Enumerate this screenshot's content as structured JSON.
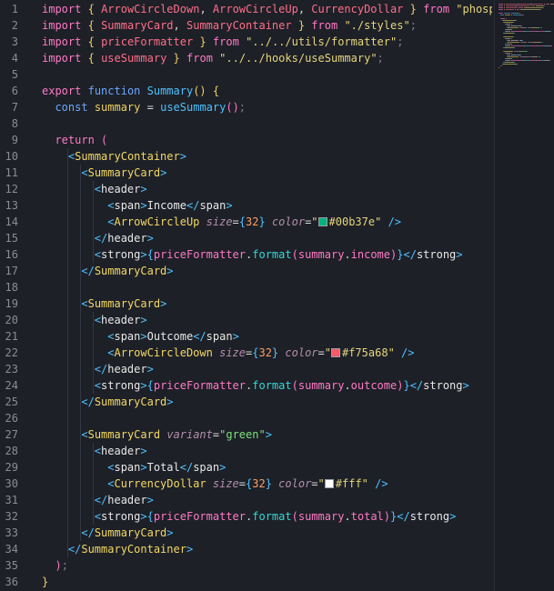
{
  "line_numbers": [
    "1",
    "2",
    "3",
    "4",
    "5",
    "6",
    "7",
    "8",
    "9",
    "10",
    "11",
    "12",
    "13",
    "14",
    "15",
    "16",
    "17",
    "18",
    "19",
    "20",
    "21",
    "22",
    "23",
    "24",
    "25",
    "26",
    "27",
    "28",
    "29",
    "30",
    "31",
    "32",
    "33",
    "34",
    "35",
    "36"
  ],
  "lines": [
    [
      [
        "import",
        "pink"
      ],
      [
        " ",
        ""
      ],
      [
        "{",
        "kw"
      ],
      [
        " ",
        ""
      ],
      [
        "ArrowCircleDown",
        "ident"
      ],
      [
        ", ",
        "punc"
      ],
      [
        "ArrowCircleUp",
        "ident"
      ],
      [
        ", ",
        "punc"
      ],
      [
        "CurrencyDollar",
        "ident"
      ],
      [
        " ",
        ""
      ],
      [
        "}",
        "kw"
      ],
      [
        " ",
        ""
      ],
      [
        "from",
        "pink"
      ],
      [
        " ",
        ""
      ],
      [
        "\"phospho",
        "str"
      ]
    ],
    [
      [
        "import",
        "pink"
      ],
      [
        " ",
        ""
      ],
      [
        "{",
        "kw"
      ],
      [
        " ",
        ""
      ],
      [
        "SummaryCard",
        "ident"
      ],
      [
        ", ",
        "punc"
      ],
      [
        "SummaryContainer",
        "ident"
      ],
      [
        " ",
        ""
      ],
      [
        "}",
        "kw"
      ],
      [
        " ",
        ""
      ],
      [
        "from",
        "pink"
      ],
      [
        " ",
        ""
      ],
      [
        "\"./styles\"",
        "str"
      ],
      [
        ";",
        "dim"
      ]
    ],
    [
      [
        "import",
        "pink"
      ],
      [
        " ",
        ""
      ],
      [
        "{",
        "kw"
      ],
      [
        " ",
        ""
      ],
      [
        "priceFormatter",
        "ident"
      ],
      [
        " ",
        ""
      ],
      [
        "}",
        "kw"
      ],
      [
        " ",
        ""
      ],
      [
        "from",
        "pink"
      ],
      [
        " ",
        ""
      ],
      [
        "\"../../utils/formatter\"",
        "str"
      ],
      [
        ";",
        "dim"
      ]
    ],
    [
      [
        "import",
        "pink"
      ],
      [
        " ",
        ""
      ],
      [
        "{",
        "kw"
      ],
      [
        " ",
        ""
      ],
      [
        "useSummary",
        "ident"
      ],
      [
        " ",
        ""
      ],
      [
        "}",
        "kw"
      ],
      [
        " ",
        ""
      ],
      [
        "from",
        "pink"
      ],
      [
        " ",
        ""
      ],
      [
        "\"../../hooks/useSummary\"",
        "str"
      ],
      [
        ";",
        "dim"
      ]
    ],
    [],
    [
      [
        "export",
        "pink"
      ],
      [
        " ",
        ""
      ],
      [
        "function",
        "funckw"
      ],
      [
        " ",
        ""
      ],
      [
        "Summary",
        "fn"
      ],
      [
        "()",
        "kw"
      ],
      [
        " ",
        ""
      ],
      [
        "{",
        "kw"
      ]
    ],
    [
      [
        "  ",
        ""
      ],
      [
        "const",
        "funckw"
      ],
      [
        " ",
        ""
      ],
      [
        "summary",
        "kw"
      ],
      [
        " ",
        ""
      ],
      [
        "=",
        "op"
      ],
      [
        " ",
        ""
      ],
      [
        "useSummary",
        "fn"
      ],
      [
        "()",
        "pink"
      ],
      [
        ";",
        "dim"
      ]
    ],
    [],
    [
      [
        "  ",
        ""
      ],
      [
        "return",
        "pink"
      ],
      [
        " ",
        ""
      ],
      [
        "(",
        "pink"
      ]
    ],
    [
      [
        "    ",
        ""
      ],
      [
        "<",
        "tagb"
      ],
      [
        "SummaryContainer",
        "tag"
      ],
      [
        ">",
        "tagb"
      ]
    ],
    [
      [
        "      ",
        ""
      ],
      [
        "<",
        "tagb"
      ],
      [
        "SummaryCard",
        "tag"
      ],
      [
        ">",
        "tagb"
      ]
    ],
    [
      [
        "        ",
        ""
      ],
      [
        "<",
        "tagb"
      ],
      [
        "header",
        "text"
      ],
      [
        ">",
        "tagb"
      ]
    ],
    [
      [
        "          ",
        ""
      ],
      [
        "<",
        "tagb"
      ],
      [
        "span",
        "text"
      ],
      [
        ">",
        "tagb"
      ],
      [
        "Income",
        "text"
      ],
      [
        "</",
        "tagb"
      ],
      [
        "span",
        "text"
      ],
      [
        ">",
        "tagb"
      ]
    ],
    [
      [
        "          ",
        ""
      ],
      [
        "<",
        "tagb"
      ],
      [
        "ArrowCircleUp",
        "tag"
      ],
      [
        " ",
        ""
      ],
      [
        "size",
        "attr"
      ],
      [
        "=",
        "op"
      ],
      [
        "{",
        "tagb"
      ],
      [
        "32",
        "num"
      ],
      [
        "}",
        "tagb"
      ],
      [
        " ",
        ""
      ],
      [
        "color",
        "attr"
      ],
      [
        "=",
        "op"
      ],
      [
        "\"",
        "str"
      ],
      [
        "SW:#00b37e",
        ""
      ],
      [
        "#00b37e",
        "str"
      ],
      [
        "\"",
        "str"
      ],
      [
        " ",
        ""
      ],
      [
        "/>",
        "tagb"
      ]
    ],
    [
      [
        "        ",
        ""
      ],
      [
        "</",
        "tagb"
      ],
      [
        "header",
        "text"
      ],
      [
        ">",
        "tagb"
      ]
    ],
    [
      [
        "        ",
        ""
      ],
      [
        "<",
        "tagb"
      ],
      [
        "strong",
        "text"
      ],
      [
        ">",
        "tagb"
      ],
      [
        "{",
        "tagb"
      ],
      [
        "priceFormatter",
        "pink"
      ],
      [
        ".",
        "op"
      ],
      [
        "format",
        "cyan"
      ],
      [
        "(",
        "pink"
      ],
      [
        "summary",
        "pink"
      ],
      [
        ".",
        "op"
      ],
      [
        "income",
        "pink"
      ],
      [
        ")",
        "pink"
      ],
      [
        "}",
        "tagb"
      ],
      [
        "</",
        "tagb"
      ],
      [
        "strong",
        "text"
      ],
      [
        ">",
        "tagb"
      ]
    ],
    [
      [
        "      ",
        ""
      ],
      [
        "</",
        "tagb"
      ],
      [
        "SummaryCard",
        "tag"
      ],
      [
        ">",
        "tagb"
      ]
    ],
    [],
    [
      [
        "      ",
        ""
      ],
      [
        "<",
        "tagb"
      ],
      [
        "SummaryCard",
        "tag"
      ],
      [
        ">",
        "tagb"
      ]
    ],
    [
      [
        "        ",
        ""
      ],
      [
        "<",
        "tagb"
      ],
      [
        "header",
        "text"
      ],
      [
        ">",
        "tagb"
      ]
    ],
    [
      [
        "          ",
        ""
      ],
      [
        "<",
        "tagb"
      ],
      [
        "span",
        "text"
      ],
      [
        ">",
        "tagb"
      ],
      [
        "Outcome",
        "text"
      ],
      [
        "</",
        "tagb"
      ],
      [
        "span",
        "text"
      ],
      [
        ">",
        "tagb"
      ]
    ],
    [
      [
        "          ",
        ""
      ],
      [
        "<",
        "tagb"
      ],
      [
        "ArrowCircleDown",
        "tag"
      ],
      [
        " ",
        ""
      ],
      [
        "size",
        "attr"
      ],
      [
        "=",
        "op"
      ],
      [
        "{",
        "tagb"
      ],
      [
        "32",
        "num"
      ],
      [
        "}",
        "tagb"
      ],
      [
        " ",
        ""
      ],
      [
        "color",
        "attr"
      ],
      [
        "=",
        "op"
      ],
      [
        "\"",
        "str"
      ],
      [
        "SW:#f75a68",
        ""
      ],
      [
        "#f75a68",
        "str"
      ],
      [
        "\"",
        "str"
      ],
      [
        " ",
        ""
      ],
      [
        "/>",
        "tagb"
      ]
    ],
    [
      [
        "        ",
        ""
      ],
      [
        "</",
        "tagb"
      ],
      [
        "header",
        "text"
      ],
      [
        ">",
        "tagb"
      ]
    ],
    [
      [
        "        ",
        ""
      ],
      [
        "<",
        "tagb"
      ],
      [
        "strong",
        "text"
      ],
      [
        ">",
        "tagb"
      ],
      [
        "{",
        "tagb"
      ],
      [
        "priceFormatter",
        "pink"
      ],
      [
        ".",
        "op"
      ],
      [
        "format",
        "cyan"
      ],
      [
        "(",
        "pink"
      ],
      [
        "summary",
        "pink"
      ],
      [
        ".",
        "op"
      ],
      [
        "outcome",
        "pink"
      ],
      [
        ")",
        "pink"
      ],
      [
        "}",
        "tagb"
      ],
      [
        "</",
        "tagb"
      ],
      [
        "strong",
        "text"
      ],
      [
        ">",
        "tagb"
      ]
    ],
    [
      [
        "      ",
        ""
      ],
      [
        "</",
        "tagb"
      ],
      [
        "SummaryCard",
        "tag"
      ],
      [
        ">",
        "tagb"
      ]
    ],
    [],
    [
      [
        "      ",
        ""
      ],
      [
        "<",
        "tagb"
      ],
      [
        "SummaryCard",
        "tag"
      ],
      [
        " ",
        ""
      ],
      [
        "variant",
        "attr"
      ],
      [
        "=",
        "op"
      ],
      [
        "\"green\"",
        "green"
      ],
      [
        ">",
        "tagb"
      ]
    ],
    [
      [
        "        ",
        ""
      ],
      [
        "<",
        "tagb"
      ],
      [
        "header",
        "text"
      ],
      [
        ">",
        "tagb"
      ]
    ],
    [
      [
        "          ",
        ""
      ],
      [
        "<",
        "tagb"
      ],
      [
        "span",
        "text"
      ],
      [
        ">",
        "tagb"
      ],
      [
        "Total",
        "text"
      ],
      [
        "</",
        "tagb"
      ],
      [
        "span",
        "text"
      ],
      [
        ">",
        "tagb"
      ]
    ],
    [
      [
        "          ",
        ""
      ],
      [
        "<",
        "tagb"
      ],
      [
        "CurrencyDollar",
        "tag"
      ],
      [
        " ",
        ""
      ],
      [
        "size",
        "attr"
      ],
      [
        "=",
        "op"
      ],
      [
        "{",
        "tagb"
      ],
      [
        "32",
        "num"
      ],
      [
        "}",
        "tagb"
      ],
      [
        " ",
        ""
      ],
      [
        "color",
        "attr"
      ],
      [
        "=",
        "op"
      ],
      [
        "\"",
        "str"
      ],
      [
        "SW:#ffffff",
        ""
      ],
      [
        "#fff",
        "str"
      ],
      [
        "\"",
        "str"
      ],
      [
        " ",
        ""
      ],
      [
        "/>",
        "tagb"
      ]
    ],
    [
      [
        "        ",
        ""
      ],
      [
        "</",
        "tagb"
      ],
      [
        "header",
        "text"
      ],
      [
        ">",
        "tagb"
      ]
    ],
    [
      [
        "        ",
        ""
      ],
      [
        "<",
        "tagb"
      ],
      [
        "strong",
        "text"
      ],
      [
        ">",
        "tagb"
      ],
      [
        "{",
        "tagb"
      ],
      [
        "priceFormatter",
        "pink"
      ],
      [
        ".",
        "op"
      ],
      [
        "format",
        "cyan"
      ],
      [
        "(",
        "pink"
      ],
      [
        "summary",
        "pink"
      ],
      [
        ".",
        "op"
      ],
      [
        "total",
        "pink"
      ],
      [
        ")",
        "pink"
      ],
      [
        "}",
        "tagb"
      ],
      [
        "</",
        "tagb"
      ],
      [
        "strong",
        "text"
      ],
      [
        ">",
        "tagb"
      ]
    ],
    [
      [
        "      ",
        ""
      ],
      [
        "</",
        "tagb"
      ],
      [
        "SummaryCard",
        "tag"
      ],
      [
        ">",
        "tagb"
      ]
    ],
    [
      [
        "    ",
        ""
      ],
      [
        "</",
        "tagb"
      ],
      [
        "SummaryContainer",
        "tag"
      ],
      [
        ">",
        "tagb"
      ]
    ],
    [
      [
        "  ",
        ""
      ],
      [
        ")",
        "pink"
      ],
      [
        ";",
        "dim"
      ]
    ],
    [
      [
        "}",
        "kw"
      ]
    ]
  ],
  "colors": {
    "background": "#1d2027",
    "line_number": "#8a8d96",
    "swatch_income": "#00b37e",
    "swatch_outcome": "#f75a68",
    "swatch_total": "#ffffff"
  }
}
